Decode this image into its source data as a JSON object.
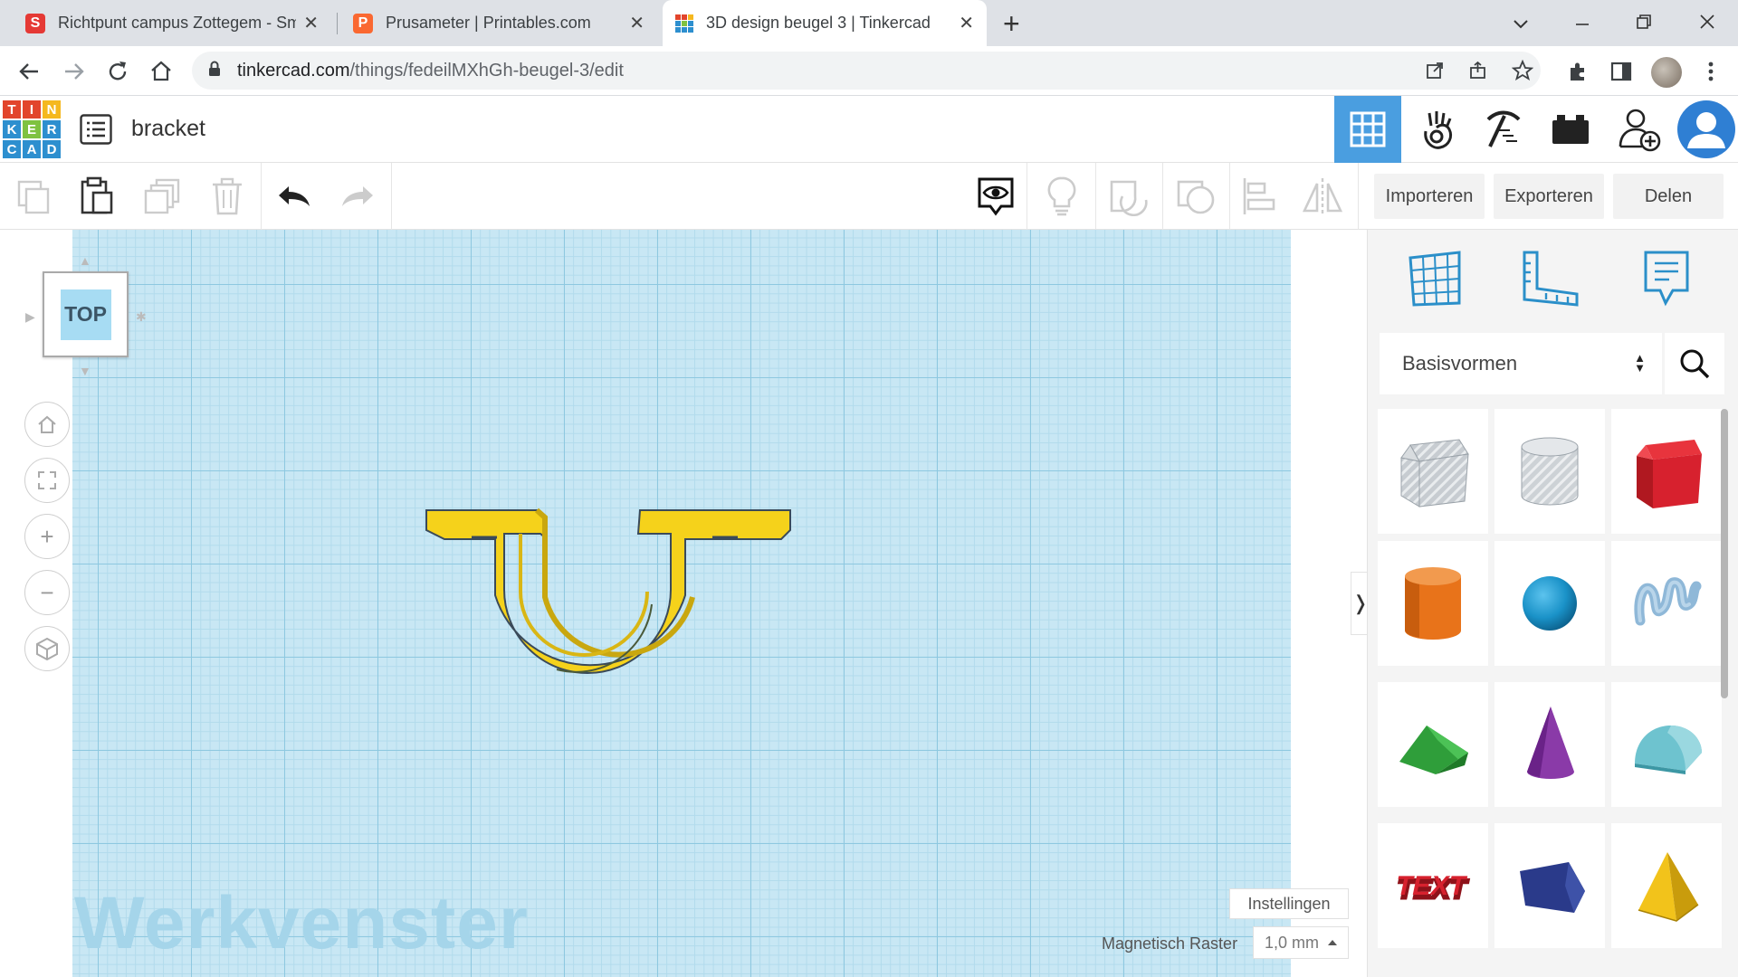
{
  "browser": {
    "tabs": [
      {
        "title": "Richtpunt campus Zottegem - Sm",
        "favicon": "S",
        "favicon_color": "#e53935"
      },
      {
        "title": "Prusameter | Printables.com",
        "favicon": "P",
        "favicon_color": "#fa6831"
      },
      {
        "title": "3D design beugel 3 | Tinkercad",
        "favicon": "",
        "favicon_color": "#ffffff"
      }
    ],
    "close_glyph": "✕",
    "new_tab_glyph": "+",
    "url_host": "tinkercad.com",
    "url_path": "/things/fedeilMXhGh-beugel-3/edit"
  },
  "tinkercad": {
    "logo_letters": [
      "T",
      "I",
      "N",
      "K",
      "E",
      "R",
      "C",
      "A",
      "D"
    ],
    "logo_colors": [
      "#e2452c",
      "#e2452c",
      "#f5b81f",
      "#2d8fcf",
      "#7fc241",
      "#2d8fcf",
      "#2d8fcf",
      "#2d8fcf",
      "#2d8fcf"
    ],
    "design_title": "bracket",
    "accent": "#4a9ee0"
  },
  "toolbar": {
    "import_label": "Importeren",
    "export_label": "Exporteren",
    "share_label": "Delen"
  },
  "workplane": {
    "watermark": "Werkvenster",
    "viewcube_face": "TOP",
    "settings_label": "Instellingen",
    "snap_label": "Magnetisch Raster",
    "snap_value": "1,0 mm",
    "toggle_glyph": "❭",
    "zoom_in_glyph": "+",
    "zoom_out_glyph": "−",
    "object_color": "#f5d21b"
  },
  "panel": {
    "library_selected": "Basisvormen",
    "library_arrows": "▲▼",
    "shapes": [
      {
        "name": "box-hole",
        "color": "#b9c0c6"
      },
      {
        "name": "cylinder-hole",
        "color": "#c9cfd3"
      },
      {
        "name": "box",
        "color": "#d7212e"
      },
      {
        "name": "cylinder",
        "color": "#e8731a"
      },
      {
        "name": "sphere",
        "color": "#1a92c8"
      },
      {
        "name": "scribble",
        "color": "#8fb8d8"
      },
      {
        "name": "roof",
        "color": "#2f9e3a"
      },
      {
        "name": "cone",
        "color": "#8a3aa8"
      },
      {
        "name": "round-roof",
        "color": "#6ec3cf"
      },
      {
        "name": "text",
        "color": "#c8202a"
      },
      {
        "name": "polygon",
        "color": "#2a3a8a"
      },
      {
        "name": "pyramid",
        "color": "#f2c31b"
      }
    ]
  }
}
